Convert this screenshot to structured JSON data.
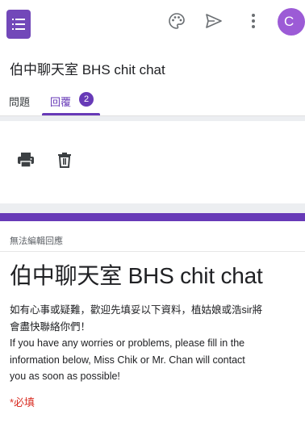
{
  "header": {
    "icons": [
      "form-app-icon",
      "palette-icon",
      "send-icon",
      "more-vert-icon"
    ],
    "avatar_initial": "C"
  },
  "form": {
    "title": "伯中聊天室 BHS chit chat"
  },
  "tabs": [
    {
      "label": "問題"
    },
    {
      "label": "回覆",
      "badge": "2",
      "active": true
    }
  ],
  "actions": {
    "icons": [
      "print-icon",
      "trash-icon"
    ]
  },
  "response": {
    "readonly_note": "無法編輯回應",
    "heading": "伯中聊天室 BHS chit chat",
    "description_lines": [
      "如有心事或疑難，歡迎先填妥以下資料，植姑娘或浩sir將",
      "會盡快聯絡你們！",
      "If you have any worries or problems, please fill in the",
      "information below, Miss Chik or Mr. Chan will contact",
      "you as soon as possible!"
    ],
    "required_note": "*必填"
  },
  "colors": {
    "accent": "#673ab7",
    "avatar": "#9c5bd6",
    "required": "#d93025",
    "background": "#eceef1"
  }
}
